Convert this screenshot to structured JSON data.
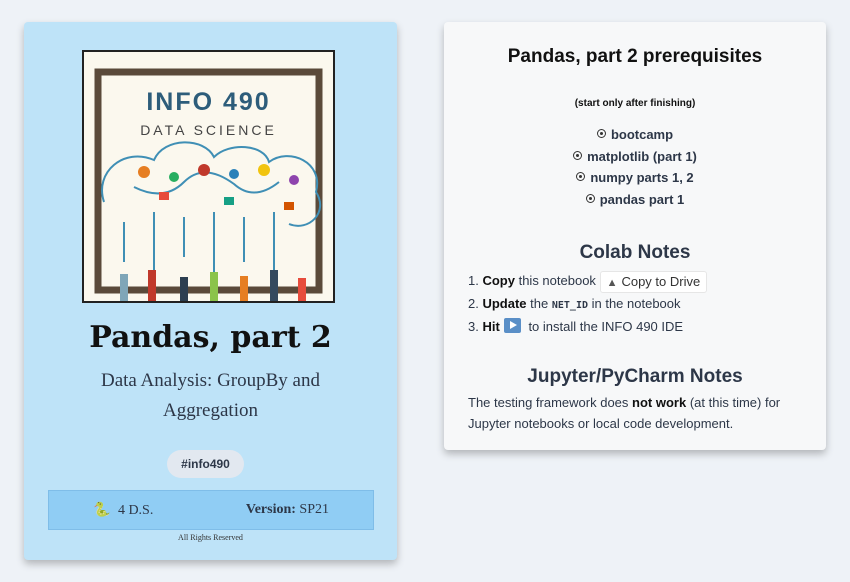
{
  "left_card": {
    "cover": {
      "title": "INFO 490",
      "subtitle": "DATA SCIENCE"
    },
    "title": "Pandas, part 2",
    "subtitle": "Data Analysis: GroupBy and Aggregation",
    "hashtag": "#info490",
    "footer": {
      "left_text": "4 D.S.",
      "version_label": "Version:",
      "version_value": "SP21"
    },
    "rights": "All Rights Reserved"
  },
  "right_card": {
    "prereq_title": "Pandas, part 2 prerequisites",
    "prereq_note": "(start only after finishing)",
    "prereq_items": [
      "bootcamp",
      "matplotlib (part 1)",
      "numpy parts 1, 2",
      "pandas part 1"
    ],
    "colab": {
      "heading": "Colab Notes",
      "step1_bold": "Copy",
      "step1_text": "this notebook",
      "drive_button": "Copy to Drive",
      "step2_bold": "Update",
      "step2_pre": "the",
      "step2_code": "NET_ID",
      "step2_post": "in the notebook",
      "step3_bold": "Hit",
      "step3_text": "to install the INFO 490 IDE"
    },
    "jupyter": {
      "heading": "Jupyter/PyCharm Notes",
      "text_pre": "The testing framework does",
      "text_bold": "not work",
      "text_post": "(at this time) for Jupyter notebooks or local code development."
    }
  }
}
